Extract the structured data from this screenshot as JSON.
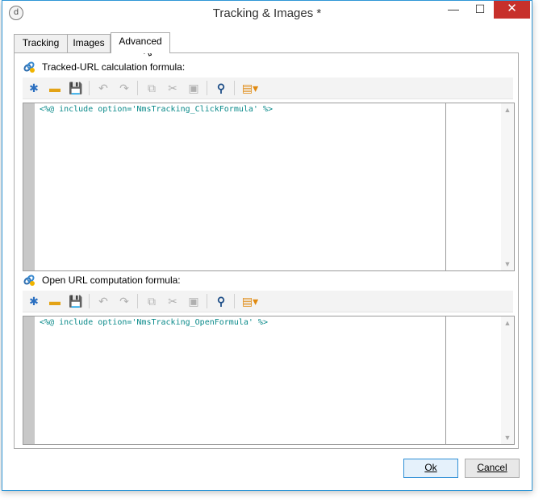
{
  "window": {
    "title": "Tracking & Images *",
    "app_icon_glyph": "d",
    "controls": {
      "minimize": "—",
      "maximize": "☐",
      "close": "✕"
    }
  },
  "tabs": [
    {
      "label": "Tracking",
      "active": false
    },
    {
      "label": "Images",
      "active": false
    },
    {
      "label": "Advanced",
      "active": true
    }
  ],
  "sections": {
    "tracked": {
      "label": "Tracked-URL calculation formula:",
      "code": "<%@ include option='NmsTracking_ClickFormula' %>"
    },
    "open": {
      "label": "Open URL computation formula:",
      "code": "<%@ include option='NmsTracking_OpenFormula' %>"
    }
  },
  "toolbar_icons": [
    {
      "name": "new-icon",
      "glyph": "✱",
      "enabled": true
    },
    {
      "name": "open-folder-icon",
      "glyph": "▬",
      "enabled": true
    },
    {
      "name": "save-icon",
      "glyph": "💾",
      "enabled": true
    },
    {
      "name": "undo-icon",
      "glyph": "↶",
      "enabled": false
    },
    {
      "name": "redo-icon",
      "glyph": "↷",
      "enabled": false
    },
    {
      "name": "copy-icon",
      "glyph": "⧉",
      "enabled": false
    },
    {
      "name": "cut-icon",
      "glyph": "✂",
      "enabled": false
    },
    {
      "name": "paste-icon",
      "glyph": "▣",
      "enabled": false
    },
    {
      "name": "find-icon",
      "glyph": "⚲",
      "enabled": true
    },
    {
      "name": "insert-menu-icon",
      "glyph": "▤▾",
      "enabled": true
    }
  ],
  "footer": {
    "ok_label": "Ok",
    "cancel_label": "Cancel"
  },
  "colors": {
    "accent": "#2f96d6",
    "close_button": "#c7302b",
    "code_text": "#0a8a8a"
  }
}
